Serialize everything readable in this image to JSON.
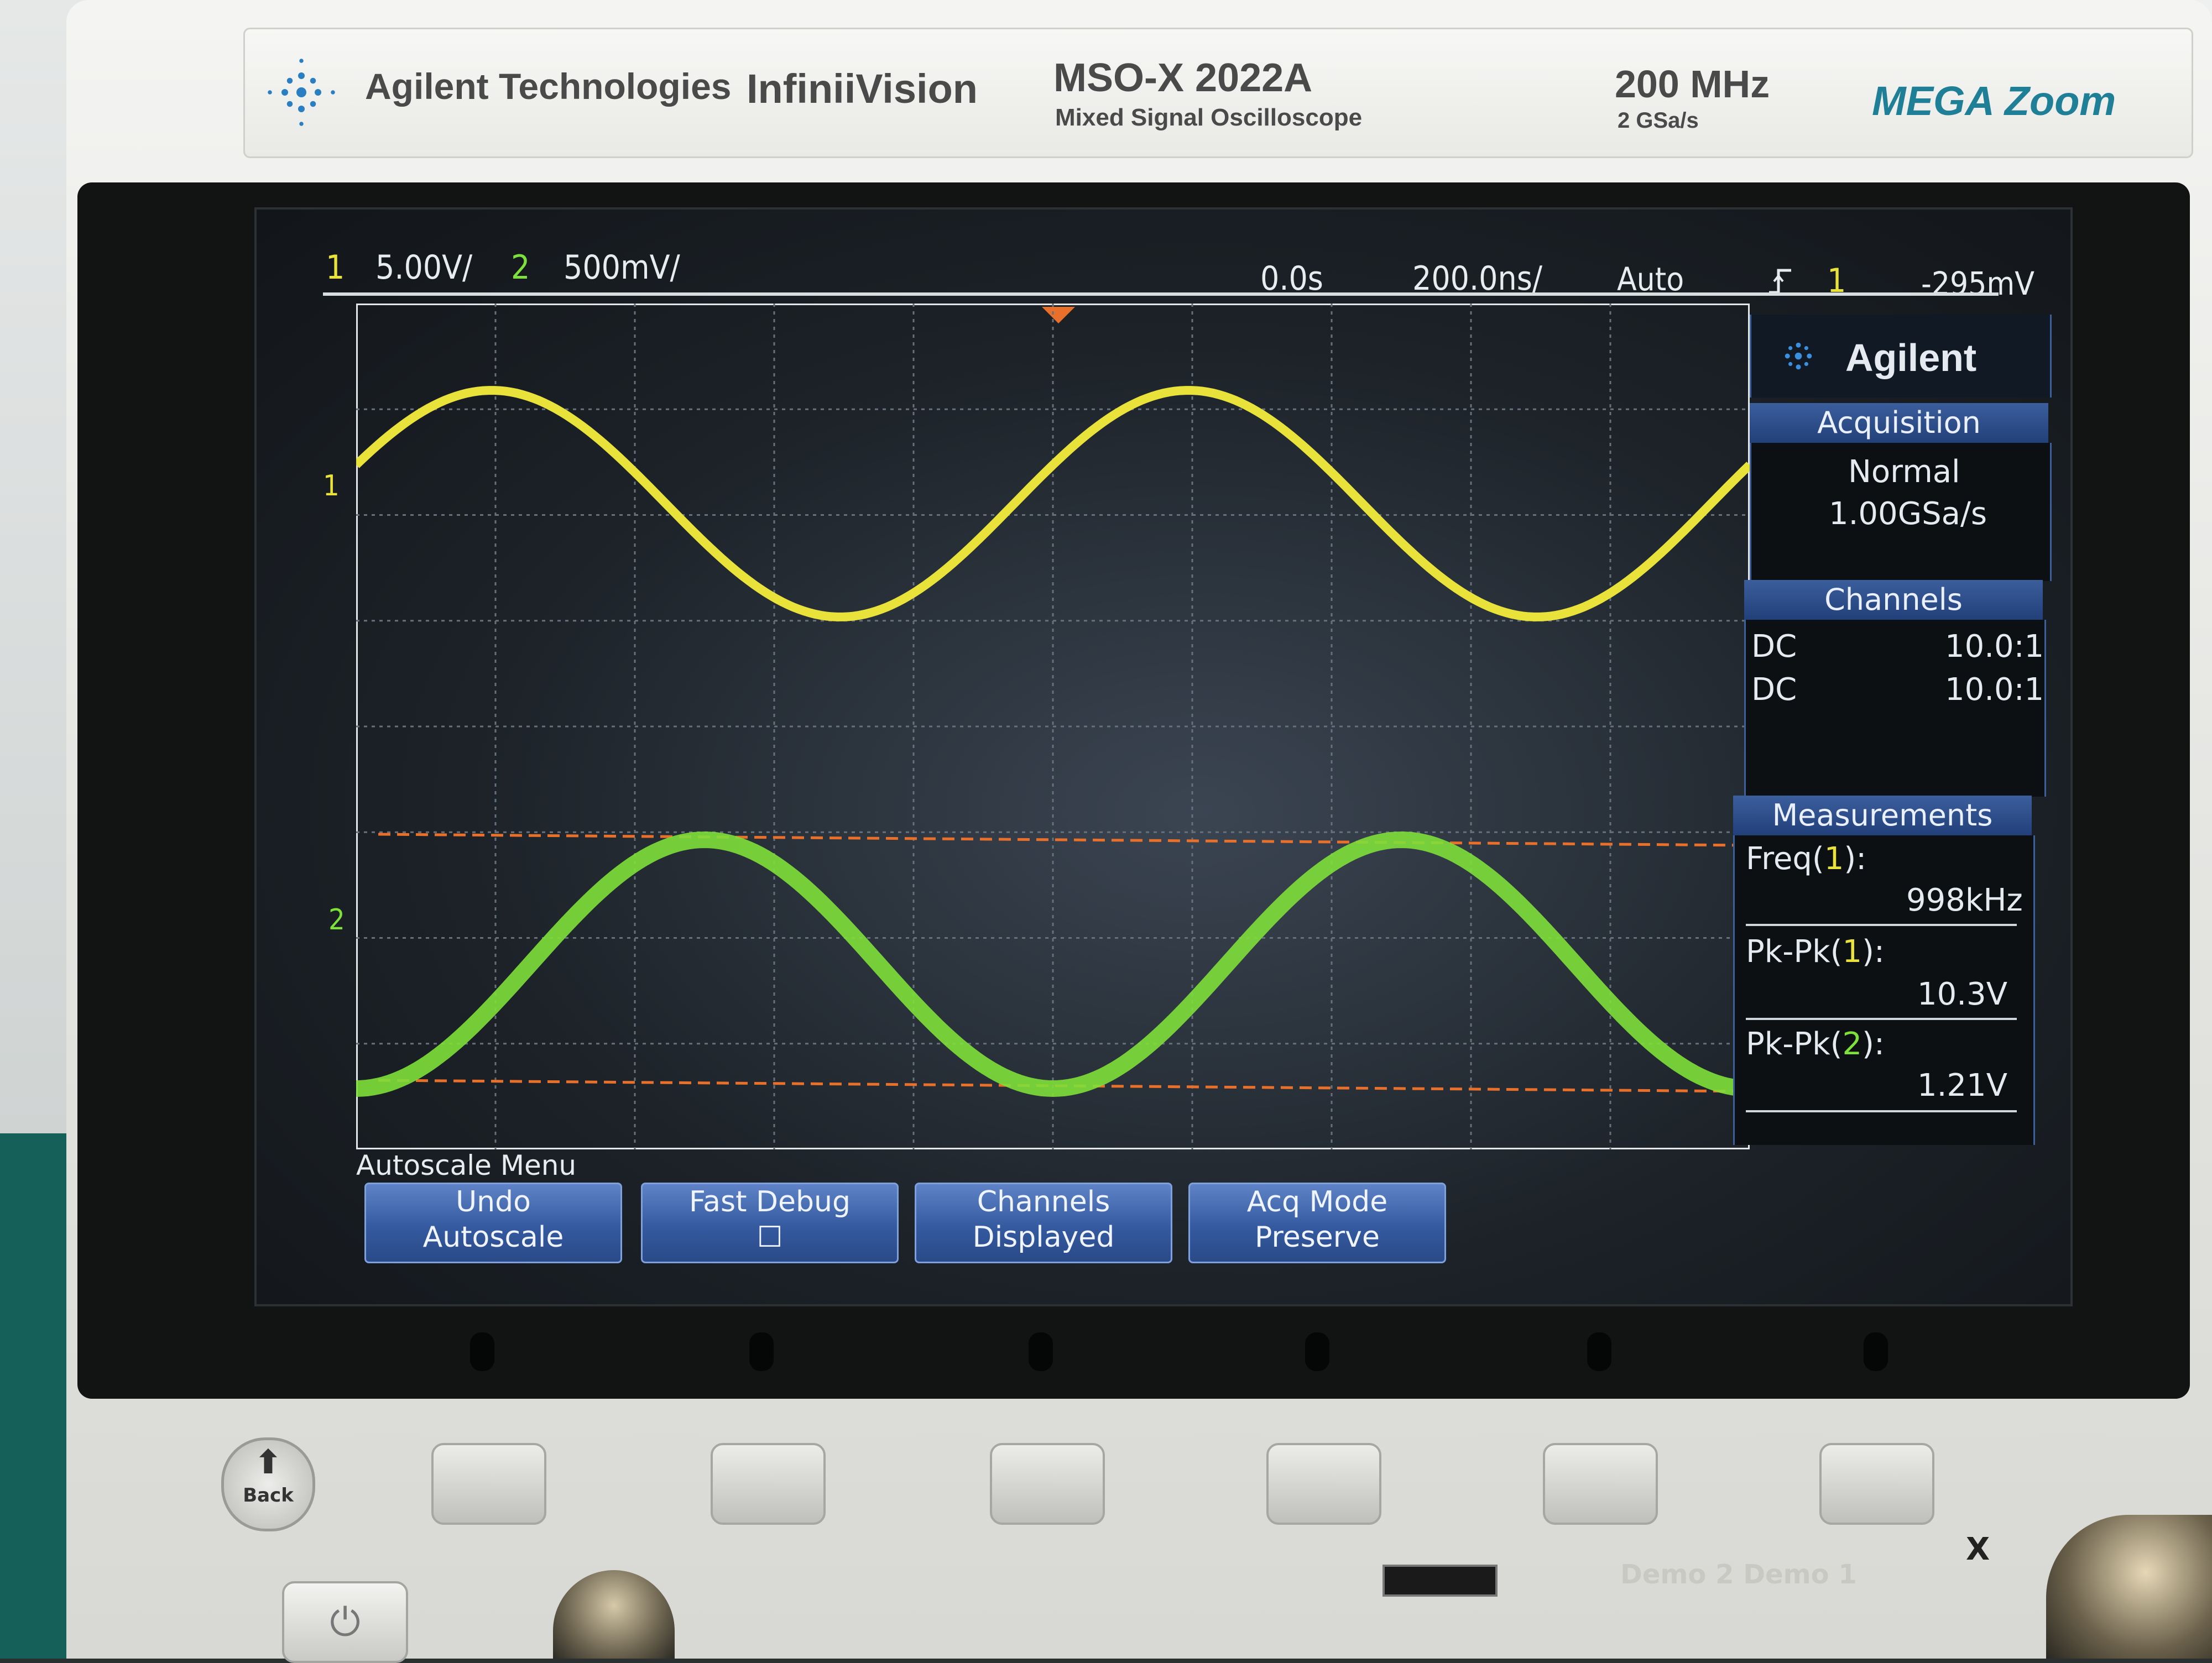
{
  "brand": {
    "company": "Agilent Technologies",
    "series": "InfiniiVision",
    "model": "MSO-X 2022A",
    "model_desc": "Mixed Signal Oscilloscope",
    "bandwidth": "200 MHz",
    "sample_rate": "2 GSa/s",
    "zoom_logo": "MEGA Zoom"
  },
  "status_bar": {
    "ch1_num": "1",
    "ch1_scale": "5.00V/",
    "ch2_num": "2",
    "ch2_scale": "500mV/",
    "time_delay": "0.0s",
    "time_scale": "200.0ns/",
    "trigger_mode": "Auto",
    "trigger_slope_icon": "rising-edge-icon",
    "trigger_source": "1",
    "trigger_level": "-295mV"
  },
  "markers": {
    "ch1": "1",
    "ch2": "2"
  },
  "side_panel": {
    "logo": "Agilent",
    "acquisition": {
      "title": "Acquisition",
      "mode": "Normal",
      "rate": "1.00GSa/s"
    },
    "channels": {
      "title": "Channels",
      "rows": [
        {
          "coupling": "DC",
          "probe": "10.0:1"
        },
        {
          "coupling": "DC",
          "probe": "10.0:1"
        }
      ]
    },
    "measurements": {
      "title": "Measurements",
      "items": [
        {
          "label_prefix": "Freq(",
          "channel": "1",
          "label_suffix": "):",
          "value": "998kHz"
        },
        {
          "label_prefix": "Pk-Pk(",
          "channel": "1",
          "label_suffix": "):",
          "value": "10.3V"
        },
        {
          "label_prefix": "Pk-Pk(",
          "channel": "2",
          "label_suffix": "):",
          "value": "1.21V"
        }
      ]
    }
  },
  "menu": {
    "title": "Autoscale Menu",
    "softkeys": [
      {
        "line1": "Undo",
        "line2": "Autoscale"
      },
      {
        "line1": "Fast Debug",
        "line2": "☐"
      },
      {
        "line1": "Channels",
        "line2": "Displayed"
      },
      {
        "line1": "Acq Mode",
        "line2": "Preserve"
      }
    ]
  },
  "hardware": {
    "back_label": "Back",
    "demo_labels": "Demo 2      Demo 1",
    "x_label": "X"
  },
  "colors": {
    "ch1": "#e8e23a",
    "ch2": "#7ee03a",
    "cursor": "#e8702a",
    "softkey": "#355aa0"
  },
  "waveforms": {
    "ch1": {
      "periods": 2.0,
      "phase_deg": 20
    },
    "ch2": {
      "periods": 2.0,
      "phase_deg": 270
    }
  }
}
